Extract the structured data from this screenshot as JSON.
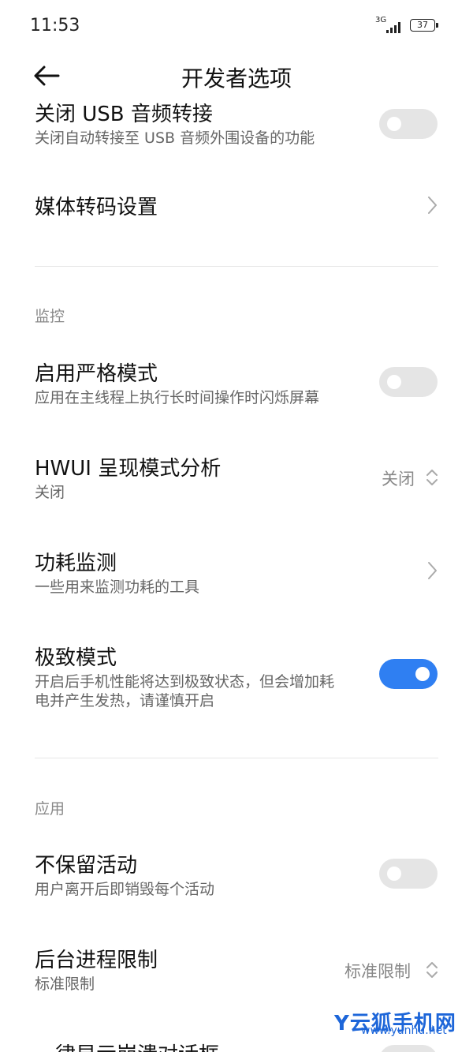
{
  "status": {
    "time": "11:53",
    "network": "3G",
    "battery": "37"
  },
  "header": {
    "title": "开发者选项"
  },
  "top_cut": {
    "title": "关闭 USB 音频转接",
    "subtitle": "关闭自动转接至 USB 音频外围设备的功能",
    "toggle_on": false
  },
  "media": {
    "title": "媒体转码设置"
  },
  "sections": {
    "monitor": "监控",
    "apps": "应用"
  },
  "strict": {
    "title": "启用严格模式",
    "subtitle": "应用在主线程上执行长时间操作时闪烁屏幕",
    "toggle_on": false
  },
  "hwui": {
    "title": "HWUI 呈现模式分析",
    "subtitle": "关闭",
    "value": "关闭"
  },
  "power": {
    "title": "功耗监测",
    "subtitle": "一些用来监测功耗的工具"
  },
  "extreme": {
    "title": "极致模式",
    "subtitle_line1": "开启后手机性能将达到极致状态，但会增加耗",
    "subtitle_line2": "电并产生发热，请谨慎开启",
    "toggle_on": true
  },
  "no_keep": {
    "title": "不保留活动",
    "subtitle": "用户离开后即销毁每个活动",
    "toggle_on": false
  },
  "bg_limit": {
    "title": "后台进程限制",
    "subtitle": "标准限制",
    "value": "标准限制"
  },
  "crash": {
    "title": "一律显示崩溃对话框"
  },
  "watermark": {
    "brand": "Y云狐手机网",
    "url": "www.yunhu.net"
  },
  "colors": {
    "accent": "#2f7ff2",
    "toggle_off": "#e5e5e5",
    "watermark": "#1d66d9"
  }
}
